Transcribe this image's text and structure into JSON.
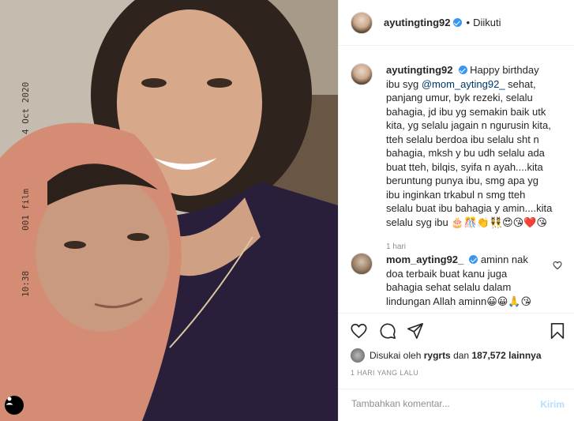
{
  "photo": {
    "date_stamp": "4 Oct 2020",
    "film_label": "001 film",
    "time_stamp": "10:38",
    "account_icon": "user-circle-icon"
  },
  "header": {
    "username": "ayutingting92",
    "separator": "•",
    "follow_state": "Diikuti",
    "verified": true
  },
  "caption": {
    "username": "ayutingting92",
    "text_before": "Happy birthday ibu syg",
    "mention": "@mom_ayting92_",
    "text_after": "sehat, panjang umur, byk rezeki, selalu bahagia, jd ibu yg semakin baik utk kita, yg selalu jagain n ngurusin kita, tteh selalu berdoa ibu selalu sht n bahagia, mksh y bu udh selalu ada buat tteh, bilqis, syifa n ayah....kita beruntung punya ibu, smg apa yg ibu inginkan trkabul n smg tteh selalu buat ibu bahagia y amin....kita selalu syg ibu 🎂🎊👏👯😍😘❤️😘",
    "time": "1 hari"
  },
  "comment": {
    "username": "mom_ayting92_",
    "text": "aminn nak doa terbaik buat kanu juga bahagia sehat selalu dalam lindungan Allah aminn😀😀🙏😘"
  },
  "likes": {
    "prefix": "Disukai oleh",
    "user": "rygrts",
    "middle": "dan",
    "count": "187,572 lainnya"
  },
  "date": "1 HARI YANG LALU",
  "composer": {
    "placeholder": "Tambahkan komentar...",
    "post_label": "Kirim"
  },
  "colors": {
    "verified": "#3897f0",
    "mention": "#00376b",
    "post_disabled": "#b2dffc"
  }
}
